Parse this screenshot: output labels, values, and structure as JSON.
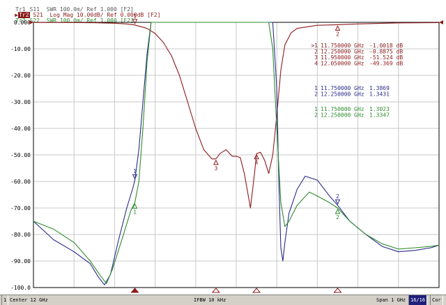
{
  "traces_header": {
    "tr1": {
      "tag": "Tr1",
      "text": "S11  SWR 100.0m/ Ref 1.000 [F2]"
    },
    "tr2": {
      "tag": "Tr2",
      "text": "S21  Log Mag 10.00dB/ Ref 0.000dB [F2]"
    },
    "tr3": {
      "tag": "Tr3",
      "text": "S22  SWR 100.0m/ Ref 1.000 [F2]"
    }
  },
  "colors": {
    "s11": "#2a2a8a",
    "s21": "#8b1a1a",
    "s22": "#2e8b2e",
    "grid": "#c8c8c8",
    "frame": "#000000"
  },
  "marker_table": {
    "s21": [
      {
        "label": ">1",
        "freq": "11.750000 GHz",
        "value": "-1.0018 dB"
      },
      {
        "label": "2",
        "freq": "12.250000 GHz",
        "value": "-0.8875 dB"
      },
      {
        "label": "3",
        "freq": "11.950000 GHz",
        "value": "-51.524 dB"
      },
      {
        "label": "4",
        "freq": "12.050000 GHz",
        "value": "-49.369 dB"
      }
    ],
    "s11": [
      {
        "label": "1",
        "freq": "11.750000 GHz",
        "value": "1.3869"
      },
      {
        "label": "2",
        "freq": "12.250000 GHz",
        "value": "1.3431"
      }
    ],
    "s22": [
      {
        "label": "1",
        "freq": "11.750000 GHz",
        "value": "1.3023"
      },
      {
        "label": "2",
        "freq": "12.250000 GHz",
        "value": "1.3347"
      }
    ]
  },
  "status_bar": {
    "channel": "1",
    "center": "Center 12 GHz",
    "ifbw": "IFBW 10 kHz",
    "span": "Span 1 GHz",
    "points": "16/16",
    "cor": "Cor"
  },
  "chart_data": {
    "type": "line",
    "xlabel": "",
    "ylabel": "",
    "xlim": [
      11.5,
      12.5
    ],
    "ylim": [
      -100,
      0
    ],
    "yticks": [
      "0.000",
      "-10.00",
      "-20.00",
      "-30.00",
      "-40.00",
      "-50.00",
      "-60.00",
      "-70.00",
      "-80.00",
      "-90.00",
      "-100.0"
    ],
    "ytick_values": [
      0,
      -10,
      -20,
      -30,
      -40,
      -50,
      -60,
      -70,
      -80,
      -90,
      -100
    ],
    "grid": true,
    "series": [
      {
        "name": "S21",
        "color": "#8b1a1a",
        "x": [
          11.5,
          11.55,
          11.6,
          11.65,
          11.7,
          11.73,
          11.75,
          11.78,
          11.8,
          11.82,
          11.84,
          11.86,
          11.88,
          11.9,
          11.92,
          11.94,
          11.95,
          11.96,
          11.975,
          11.99,
          12.0,
          12.01,
          12.02,
          12.035,
          12.045,
          12.05,
          12.06,
          12.07,
          12.08,
          12.09,
          12.1,
          12.11,
          12.12,
          12.135,
          12.15,
          12.2,
          12.25,
          12.3,
          12.4,
          12.5
        ],
        "values": [
          -0.05,
          -0.05,
          -0.08,
          -0.15,
          -0.35,
          -0.6,
          -1.0,
          -2.3,
          -4.2,
          -7.5,
          -12.5,
          -20.0,
          -30.0,
          -40.0,
          -48.0,
          -51.5,
          -51.5,
          -49.5,
          -48.0,
          -50.5,
          -50.5,
          -51.0,
          -57.0,
          -70.0,
          -57.0,
          -49.5,
          -49.0,
          -52.0,
          -57.0,
          -50.0,
          -35.0,
          -18.0,
          -8.5,
          -4.0,
          -2.3,
          -1.1,
          -0.9,
          -0.6,
          -0.2,
          -0.1
        ]
      },
      {
        "name": "S11",
        "color": "#2a2a8a",
        "x": [
          11.5,
          11.55,
          11.6,
          11.64,
          11.66,
          11.675,
          11.69,
          11.71,
          11.73,
          11.745,
          11.75,
          11.76,
          11.77,
          11.78,
          11.79,
          11.8,
          12.09,
          12.1,
          12.105,
          12.11,
          12.115,
          12.12,
          12.13,
          12.15,
          12.17,
          12.2,
          12.23,
          12.25,
          12.28,
          12.32,
          12.36,
          12.4,
          12.44,
          12.48,
          12.5
        ],
        "values": [
          -75.0,
          -82.0,
          -86.5,
          -91.0,
          -96.0,
          -99.0,
          -95.0,
          -82.0,
          -70.0,
          -62.5,
          -59.5,
          -48.0,
          -30.0,
          -12.0,
          0.0,
          0.0,
          0.0,
          -25.0,
          -60.0,
          -85.0,
          -90.0,
          -83.0,
          -72.0,
          -63.0,
          -58.0,
          -59.5,
          -65.5,
          -69.0,
          -75.0,
          -80.0,
          -84.5,
          -86.5,
          -86.0,
          -85.0,
          -84.0
        ]
      },
      {
        "name": "S22",
        "color": "#2e8b2e",
        "x": [
          11.5,
          11.55,
          11.6,
          11.64,
          11.665,
          11.68,
          11.695,
          11.72,
          11.74,
          11.75,
          11.76,
          11.77,
          11.78,
          11.79,
          11.8,
          12.08,
          12.09,
          12.1,
          12.11,
          12.12,
          12.13,
          12.15,
          12.18,
          12.2,
          12.23,
          12.25,
          12.28,
          12.32,
          12.36,
          12.4,
          12.44,
          12.48,
          12.5
        ],
        "values": [
          -75.0,
          -78.0,
          -83.0,
          -90.0,
          -95.5,
          -98.5,
          -93.0,
          -81.0,
          -71.0,
          -68.0,
          -60.0,
          -40.0,
          -15.0,
          0.0,
          0.0,
          0.0,
          -10.0,
          -40.0,
          -68.0,
          -77.0,
          -75.0,
          -69.0,
          -64.0,
          -65.5,
          -68.0,
          -70.0,
          -75.0,
          -80.0,
          -83.5,
          -85.5,
          -85.0,
          -84.5,
          -84.0
        ]
      }
    ],
    "markers": [
      {
        "trace": "S21",
        "label": "1",
        "x": 11.75,
        "y": -1.0018,
        "place": "above"
      },
      {
        "trace": "S21",
        "label": "2",
        "x": 12.25,
        "y": -0.8875,
        "place": "below"
      },
      {
        "trace": "S21",
        "label": "3",
        "x": 11.95,
        "y": -51.524,
        "place": "below"
      },
      {
        "trace": "S21",
        "label": "4",
        "x": 12.05,
        "y": -49.369,
        "place": "below"
      },
      {
        "trace": "S11",
        "label": "1",
        "x": 11.75,
        "y": -59.5,
        "place": "above"
      },
      {
        "trace": "S11",
        "label": "2",
        "x": 12.25,
        "y": -69.0,
        "place": "above"
      },
      {
        "trace": "S22",
        "label": "1",
        "x": 11.75,
        "y": -68.0,
        "place": "below"
      },
      {
        "trace": "S22",
        "label": "2",
        "x": 12.25,
        "y": -70.0,
        "place": "below"
      }
    ],
    "bottom_markers": [
      {
        "x": 11.75,
        "active": true
      },
      {
        "x": 11.95,
        "active": false
      },
      {
        "x": 12.05,
        "active": false
      },
      {
        "x": 12.25,
        "active": false
      }
    ]
  }
}
